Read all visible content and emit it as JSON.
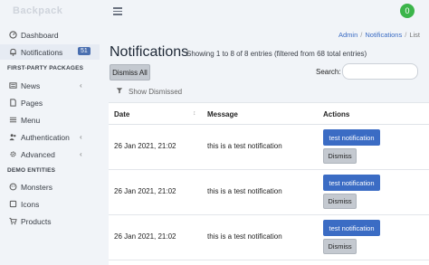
{
  "app": {
    "brand": "Backpack",
    "avatar_initial": "0"
  },
  "sidebar": {
    "items": [
      {
        "label": "Dashboard",
        "icon": "dashboard-icon"
      },
      {
        "label": "Notifications",
        "icon": "bell-icon",
        "badge": "51",
        "active": true
      }
    ],
    "section1": "FIRST-PARTY PACKAGES",
    "packages": [
      {
        "label": "News",
        "icon": "news-icon",
        "chevron": "‹"
      },
      {
        "label": "Pages",
        "icon": "file-icon"
      },
      {
        "label": "Menu",
        "icon": "list-icon"
      },
      {
        "label": "Authentication",
        "icon": "group-icon",
        "chevron": "‹"
      },
      {
        "label": "Advanced",
        "icon": "cogs-icon",
        "chevron": "‹"
      }
    ],
    "section2": "DEMO ENTITIES",
    "demo": [
      {
        "label": "Monsters",
        "icon": "monster-icon"
      },
      {
        "label": "Icons",
        "icon": "icons-icon"
      },
      {
        "label": "Products",
        "icon": "cart-icon"
      }
    ]
  },
  "breadcrumb": {
    "items": [
      "Admin",
      "Notifications"
    ],
    "current": "List"
  },
  "main": {
    "title": "Notifications",
    "subtitle": "Showing 1 to 8 of 8 entries (filtered from 68 total entries)",
    "dismiss_all": "Dismiss All",
    "search_label": "Search:",
    "search_value": "",
    "show_dismissed": "Show Dismissed"
  },
  "table": {
    "columns": [
      "Date",
      "Message",
      "Actions"
    ],
    "sort_icon": "↕",
    "rows": [
      {
        "date": "26 Jan 2021, 21:02",
        "message": "this is a test notification",
        "action": "test notification",
        "dismiss": "Dismiss"
      },
      {
        "date": "26 Jan 2021, 21:02",
        "message": "this is a test notification",
        "action": "test notification",
        "dismiss": "Dismiss"
      },
      {
        "date": "26 Jan 2021, 21:02",
        "message": "this is a test notification",
        "action": "test notification",
        "dismiss": "Dismiss"
      }
    ]
  },
  "colors": {
    "accent": "#3b6cc4",
    "avatar": "#3bb54a",
    "badge": "#4a6fb0"
  }
}
